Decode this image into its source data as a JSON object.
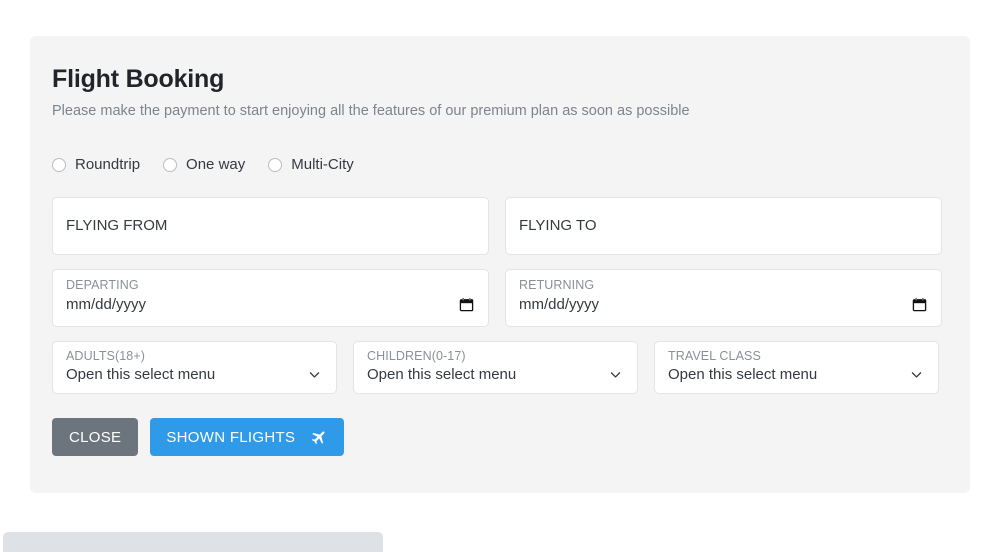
{
  "card": {
    "title": "Flight Booking",
    "subtitle": "Please make the payment to start enjoying all the features of our premium plan as soon as possible"
  },
  "trip_type": {
    "options": [
      {
        "label": "Roundtrip",
        "selected": false
      },
      {
        "label": "One way",
        "selected": false
      },
      {
        "label": "Multi-City",
        "selected": false
      }
    ]
  },
  "fields": {
    "flying_from": {
      "label": "FLYING FROM",
      "value": ""
    },
    "flying_to": {
      "label": "FLYING TO",
      "value": ""
    },
    "departing": {
      "label": "DEPARTING",
      "value": "mm/dd/yyyy"
    },
    "returning": {
      "label": "RETURNING",
      "value": "mm/dd/yyyy"
    },
    "adults": {
      "label": "ADULTS(18+)",
      "value": "Open this select menu"
    },
    "children": {
      "label": "CHILDREN(0-17)",
      "value": "Open this select menu"
    },
    "travel_class": {
      "label": "TRAVEL CLASS",
      "value": "Open this select menu"
    }
  },
  "buttons": {
    "close": "CLOSE",
    "submit": "SHOWN FLIGHTS"
  },
  "colors": {
    "primary": "#2f9ae8",
    "secondary": "#6c757d",
    "card_bg": "#f4f4f5",
    "muted_text": "#7c848d"
  }
}
